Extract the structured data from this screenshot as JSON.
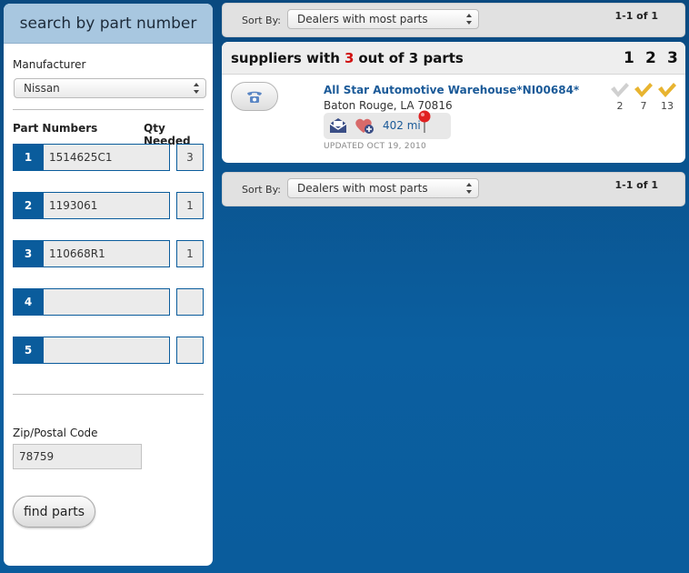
{
  "search_panel": {
    "title": "search by part number",
    "manufacturer_label": "Manufacturer",
    "manufacturer_value": "Nissan",
    "part_numbers_label": "Part Numbers",
    "qty_needed_label": "Qty Needed",
    "rows": [
      {
        "index": "1",
        "part": "1514625C1",
        "qty": "3"
      },
      {
        "index": "2",
        "part": "1193061",
        "qty": "1"
      },
      {
        "index": "3",
        "part": "110668R1",
        "qty": "1"
      },
      {
        "index": "4",
        "part": "",
        "qty": ""
      },
      {
        "index": "5",
        "part": "",
        "qty": ""
      }
    ],
    "zip_label": "Zip/Postal Code",
    "zip_value": "78759",
    "find_button": "find parts"
  },
  "sort_bar_top": {
    "label": "Sort By:",
    "value": "Dealers with most parts",
    "pagination": "1-1 of 1"
  },
  "sort_bar_bottom": {
    "label": "Sort By:",
    "value": "Dealers with most parts",
    "pagination": "1-1 of 1"
  },
  "results": {
    "heading_prefix": "suppliers with",
    "heading_count": "3",
    "heading_suffix": "out of 3 parts",
    "column_heads": [
      "1",
      "2",
      "3"
    ],
    "dealer": {
      "name": "All Star Automotive Warehouse*NI00684*",
      "city": "Baton Rouge, LA 70816",
      "distance": "402 mi",
      "updated": "UPDATED OCT 19, 2010",
      "part_counts": [
        "2",
        "7",
        "13"
      ]
    }
  },
  "colors": {
    "accent": "#0a5c9c",
    "gold_check": "#e8b430",
    "gray_check": "#cfcfcf",
    "highlight_red": "#d01010"
  },
  "icons": [
    "phone-icon",
    "email-icon",
    "favorite-add-icon",
    "map-pin-icon",
    "check-icon"
  ]
}
